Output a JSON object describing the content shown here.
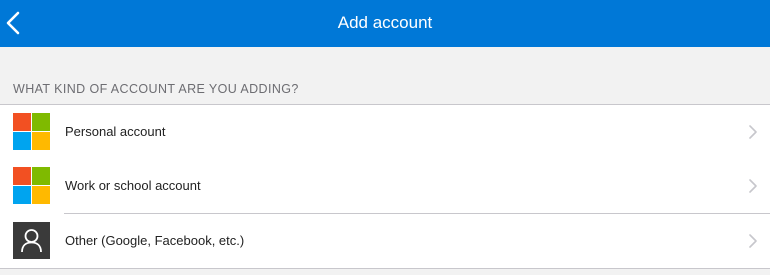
{
  "navbar": {
    "title": "Add account",
    "back_icon": "chevron-left-icon",
    "background_color": "#0078d7"
  },
  "section": {
    "header": "WHAT KIND OF ACCOUNT ARE YOU ADDING?"
  },
  "accounts": [
    {
      "label": "Personal account",
      "icon": "microsoft-logo-icon"
    },
    {
      "label": "Work or school account",
      "icon": "microsoft-logo-icon"
    },
    {
      "label": "Other (Google, Facebook, etc.)",
      "icon": "person-icon"
    }
  ],
  "colors": {
    "ms_red": "#f25022",
    "ms_green": "#7fba00",
    "ms_blue": "#00a4ef",
    "ms_yellow": "#ffb900"
  }
}
